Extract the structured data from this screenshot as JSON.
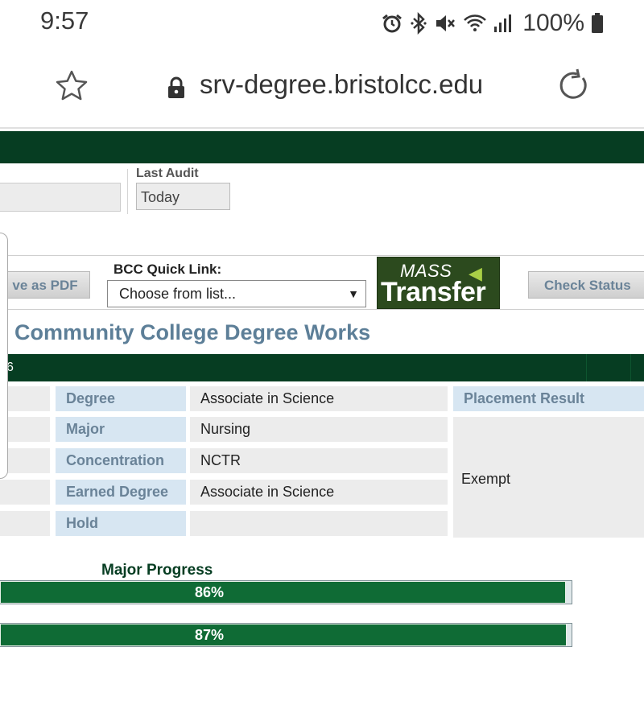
{
  "status_bar": {
    "time": "9:57",
    "battery": "100%",
    "icons": [
      "alarm-icon",
      "bluetooth-icon",
      "mute-icon",
      "wifi-icon",
      "signal-icon",
      "battery-icon"
    ]
  },
  "browser": {
    "url": "srv-degree.bristolcc.edu"
  },
  "audit": {
    "last_audit_label": "Last Audit",
    "last_audit_value": "Today"
  },
  "toolbar": {
    "save_pdf": "ve as PDF",
    "quick_link_label": "BCC Quick Link:",
    "quick_link_selected": "Choose from list...",
    "mass_transfer_line1": "MASS",
    "mass_transfer_line2": "Transfer",
    "check_status": "Check Status"
  },
  "page_title": "Community College Degree Works",
  "header_bar_text": "6",
  "student_info": {
    "rows": [
      {
        "label": "Degree",
        "value": "Associate in Science"
      },
      {
        "label": "Major",
        "value": "Nursing"
      },
      {
        "label": "Concentration",
        "value": "NCTR"
      },
      {
        "label": "Earned Degree",
        "value": "Associate in Science"
      },
      {
        "label": "Hold",
        "value": ""
      }
    ],
    "placement_label": "Placement Result",
    "placement_value": "Exempt"
  },
  "progress": {
    "label": "Major Progress",
    "bars": [
      {
        "text": "86%",
        "value": 86
      },
      {
        "text": "87%",
        "value": 87
      }
    ]
  },
  "colors": {
    "dark_green": "#063d22",
    "bar_green": "#0f6b35",
    "label_blue": "#6a8398",
    "label_bg": "#d7e6f2"
  }
}
